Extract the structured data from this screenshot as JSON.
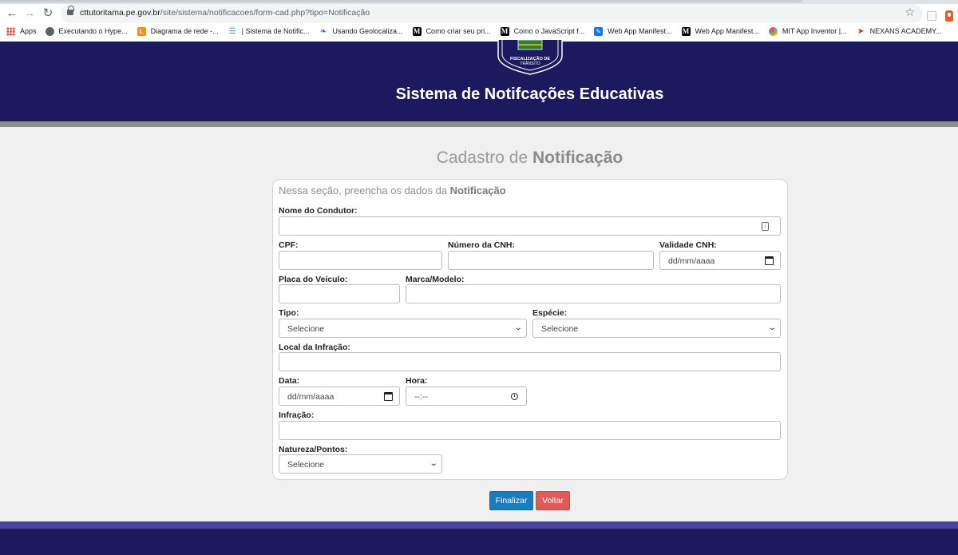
{
  "browser": {
    "url_host": "cttutoritama.pe.gov.br",
    "url_rest": "/site/sistema/notificacoes/form-cad.php?tipo=Notificação",
    "bookmarks": [
      {
        "label": "Apps",
        "icon": "apps-grid-icon"
      },
      {
        "label": "Executando o Hype...",
        "icon": "globe-icon"
      },
      {
        "label": "Diagrama de rede -...",
        "icon": "orange-page-icon"
      },
      {
        "label": "| Sistema de Notific...",
        "icon": "blue-site-icon"
      },
      {
        "label": "Usando Geolocaliza...",
        "icon": "geo-icon"
      },
      {
        "label": "Como criar seu pri...",
        "icon": "medium-icon"
      },
      {
        "label": "Como o JavaScript f...",
        "icon": "medium-icon"
      },
      {
        "label": "Web App Manifest...",
        "icon": "manifest-icon"
      },
      {
        "label": "Web App Manifest...",
        "icon": "medium-icon"
      },
      {
        "label": "MIT App Inventor |...",
        "icon": "mit-icon"
      },
      {
        "label": "NEXANS ACADEMY...",
        "icon": "nexans-icon"
      }
    ]
  },
  "header": {
    "title": "Sistema de Notifcações Educativas",
    "logo_text_1": "FISCALIZAÇÃO DE",
    "logo_text_2": "TRÂNSITO"
  },
  "main": {
    "heading_prefix": "Cadastro de ",
    "heading_strong": "Notificação",
    "intro_prefix": "Nessa seção, preencha os dados da ",
    "intro_strong": "Notificação"
  },
  "form": {
    "nome_condutor": {
      "label": "Nome do Condutor:",
      "value": ""
    },
    "cpf": {
      "label": "CPF:",
      "value": ""
    },
    "numero_cnh": {
      "label": "Número da CNH:",
      "value": ""
    },
    "validade_cnh": {
      "label": "Validade CNH:",
      "value": "dd/mm/aaaa"
    },
    "placa_veiculo": {
      "label": "Placa do Veículo:",
      "value": ""
    },
    "marca_modelo": {
      "label": "Marca/Modelo:",
      "value": ""
    },
    "tipo": {
      "label": "Tipo:",
      "value": "Selecione"
    },
    "especie": {
      "label": "Espécie:",
      "value": "Selecione"
    },
    "local_infracao": {
      "label": "Local da Infração:",
      "value": ""
    },
    "data": {
      "label": "Data:",
      "value": "dd/mm/aaaa"
    },
    "hora": {
      "label": "Hora:",
      "value": "--:--"
    },
    "infracao": {
      "label": "Infração:",
      "value": ""
    },
    "natureza_pontos": {
      "label": "Natureza/Pontos:",
      "value": "Selecione"
    }
  },
  "actions": {
    "finalizar": "Finalizar",
    "voltar": "Voltar"
  },
  "colors": {
    "header_bg": "#1c1a5e",
    "finalizar_bg": "#1a7bbf",
    "voltar_bg": "#e05a5a",
    "footer_band": "#4a43a0"
  }
}
